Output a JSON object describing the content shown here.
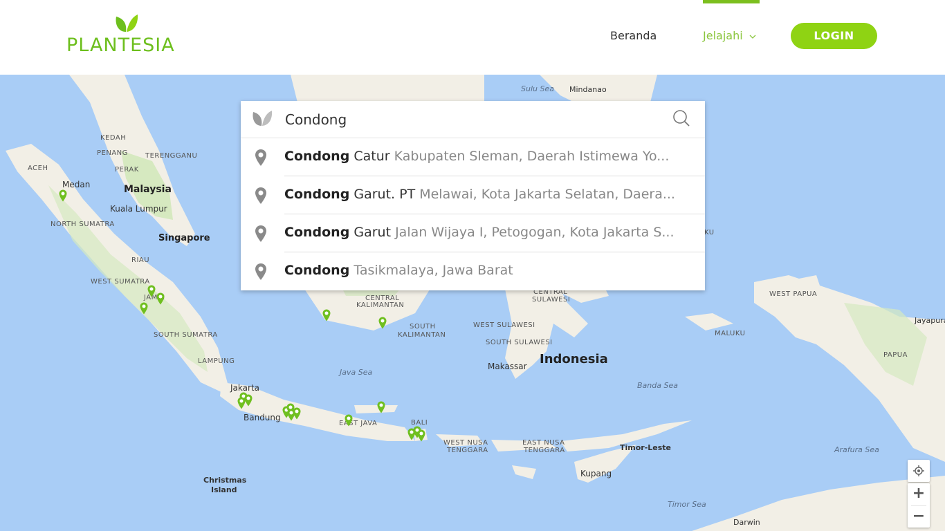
{
  "brand": {
    "name": "PLANTESIA",
    "color": "#6dbf1d"
  },
  "nav": {
    "home": "Beranda",
    "explore": "Jelajahi",
    "login": "LOGIN"
  },
  "search": {
    "value": "Condong",
    "placeholder": "",
    "suggestions": [
      {
        "bold": "Condong",
        "rest": "Catur",
        "place": "Kabupaten Sleman, Daerah Istimewa Yo..."
      },
      {
        "bold": "Condong",
        "rest": "Garut. PT",
        "place": "Melawai, Kota Jakarta Selatan, Daera..."
      },
      {
        "bold": "Condong",
        "rest": "Garut",
        "place": "Jalan Wijaya I, Petogogan, Kota Jakarta S..."
      },
      {
        "bold": "Condong",
        "rest": "",
        "place": "Tasikmalaya, Jawa Barat"
      }
    ]
  },
  "map": {
    "labels": {
      "sulu_sea": "Sulu Sea",
      "mindanao": "Mindanao",
      "kedah": "KEDAH",
      "penang": "PENANG",
      "terengganu": "TERENGGANU",
      "perak": "PERAK",
      "aceh": "ACEH",
      "medan": "Medan",
      "malaysia": "Malaysia",
      "kuala_lumpur": "Kuala Lumpur",
      "north_sumatra": "NORTH SUMATRA",
      "singapore": "Singapore",
      "riau": "RIAU",
      "west_sumatra": "WEST SUMATRA",
      "jambi": "JAMBI",
      "south_sumatra": "SOUTH SUMATRA",
      "lampung": "LAMPUNG",
      "jakarta": "Jakarta",
      "bandung": "Bandung",
      "java_sea": "Java Sea",
      "east_java": "EAST JAVA",
      "bali": "BALI",
      "central_kalimantan_1": "CENTRAL",
      "central_kalimantan_2": "KALIMANTAN",
      "south_kalimantan_1": "SOUTH",
      "south_kalimantan_2": "KALIMANTAN",
      "central_sulawesi_1": "CENTRAL",
      "central_sulawesi_2": "SULAWESI",
      "west_sulawesi": "WEST SULAWESI",
      "south_sulawesi": "SOUTH SULAWESI",
      "makassar": "Makassar",
      "indonesia": "Indonesia",
      "maluku": "MALUKU",
      "west_papua": "WEST PAPUA",
      "papua": "PAPUA",
      "jayapura": "Jayapura",
      "banda_sea": "Banda Sea",
      "west_nusa_1": "WEST NUSA",
      "west_nusa_2": "TENGGARA",
      "east_nusa_1": "EAST NUSA",
      "east_nusa_2": "TENGGARA",
      "timor_leste": "Timor-Leste",
      "kupang": "Kupang",
      "arafura_sea": "Arafura Sea",
      "timor_sea": "Timor Sea",
      "darwin": "Darwin",
      "christmas_1": "Christmas",
      "christmas_2": "Island",
      "ku": "KU"
    },
    "colors": {
      "water": "#a9cdf6",
      "land": "#f2efe6",
      "forest": "#cfe6b4",
      "pin": "#6fbf1f"
    }
  },
  "controls": {
    "zoom_in": "+",
    "zoom_out": "−"
  }
}
